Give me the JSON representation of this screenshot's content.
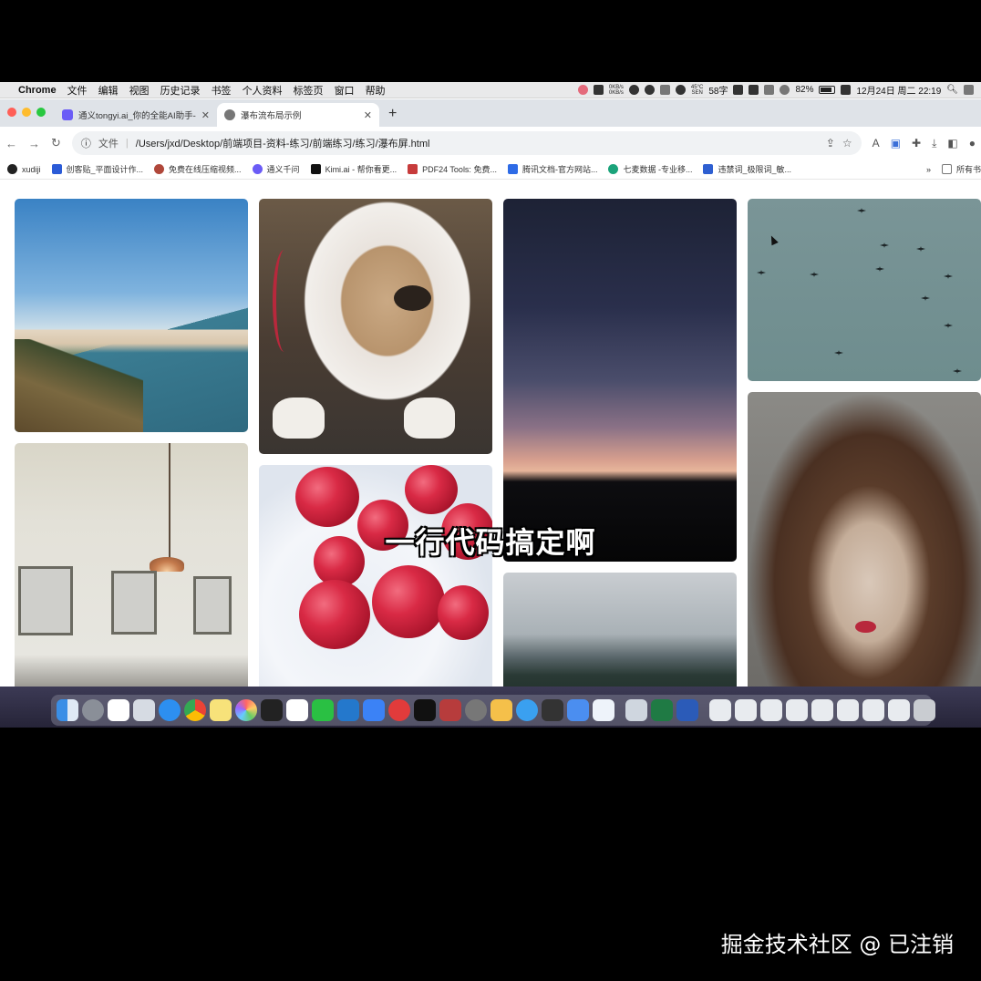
{
  "menubar": {
    "app_name": "Chrome",
    "items": [
      "文件",
      "编辑",
      "视图",
      "历史记录",
      "书签",
      "个人资料",
      "标签页",
      "窗口",
      "帮助"
    ],
    "net_up": "0KB/s",
    "net_down": "0KB/s",
    "temp": "45°C",
    "temp_sub": "SEN",
    "ime_label": "58字",
    "battery": "82%",
    "datetime": "12月24日 周二  22:19"
  },
  "tabs": [
    {
      "title": "通义tongyi.ai_你的全能AI助手-",
      "active": false,
      "favicon_color": "#6b5cf6"
    },
    {
      "title": "瀑布流布局示例",
      "active": true,
      "favicon_color": "#777777"
    }
  ],
  "toolbar": {
    "protocol_label": "文件",
    "url": "/Users/jxd/Desktop/前端项目-资料-练习/前端练习/练习/瀑布屏.html"
  },
  "bookmarks": [
    {
      "label": "xudiji",
      "color": "#222222"
    },
    {
      "label": "创客贴_平面设计作...",
      "color": "#2b5bd7"
    },
    {
      "label": "免费在线压缩视频...",
      "color": "#b0473a"
    },
    {
      "label": "通义千问",
      "color": "#6b5cf6"
    },
    {
      "label": "Kimi.ai - 帮你看更...",
      "color": "#111111"
    },
    {
      "label": "PDF24 Tools: 免费...",
      "color": "#c73b3b"
    },
    {
      "label": "腾讯文档-官方网站...",
      "color": "#2e6be6"
    },
    {
      "label": "七麦数据 -专业移...",
      "color": "#1aa37a"
    },
    {
      "label": "违禁词_极限词_敏...",
      "color": "#2e5fd1"
    }
  ],
  "bookmarks_overflow": "»",
  "bookmarks_all": "所有书",
  "gallery": [
    {
      "name": "beach-photo"
    },
    {
      "name": "dog-photo"
    },
    {
      "name": "sunset-photo"
    },
    {
      "name": "birds-photo"
    },
    {
      "name": "room-photo"
    },
    {
      "name": "raspberries-photo"
    },
    {
      "name": "forest-photo"
    },
    {
      "name": "portrait-photo"
    }
  ],
  "subtitle": "一行代码搞定啊",
  "watermark": "掘金技术社区 @ 已注销"
}
